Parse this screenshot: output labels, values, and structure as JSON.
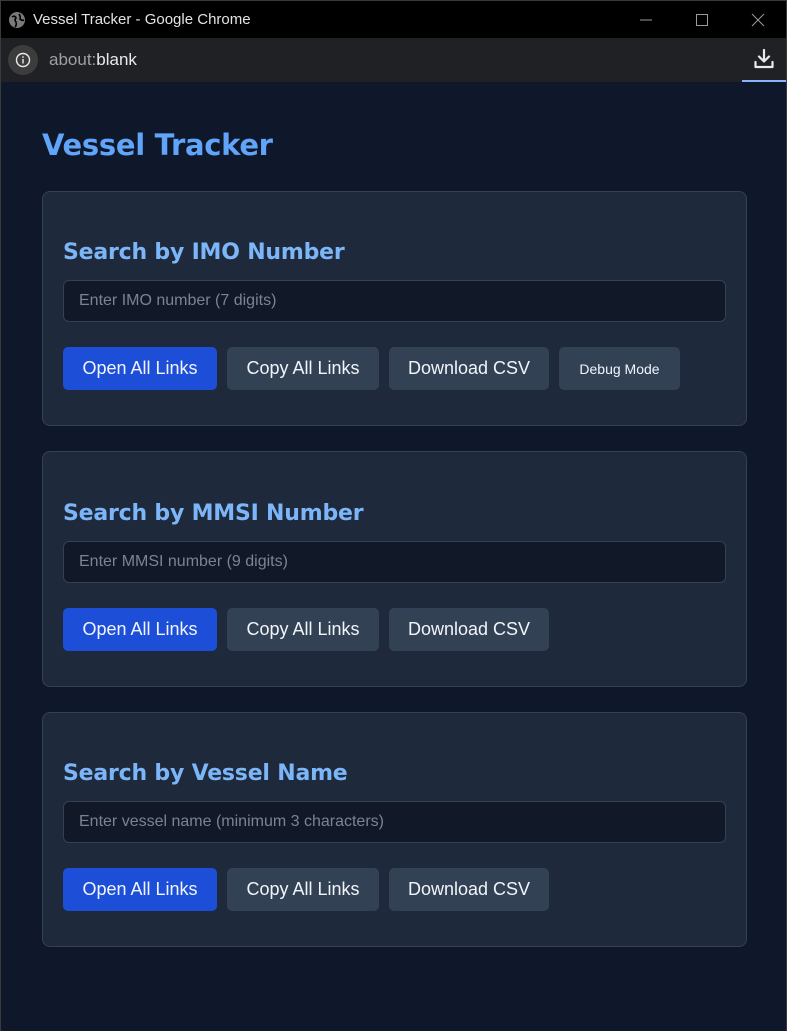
{
  "window": {
    "title": "Vessel Tracker - Google Chrome"
  },
  "address_bar": {
    "scheme": "about:",
    "host": "blank"
  },
  "page": {
    "title": "Vessel Tracker"
  },
  "sections": {
    "imo": {
      "heading": "Search by IMO Number",
      "placeholder": "Enter IMO number (7 digits)",
      "value": "",
      "open_label": "Open All Links",
      "copy_label": "Copy All Links",
      "csv_label": "Download CSV",
      "debug_label": "Debug Mode"
    },
    "mmsi": {
      "heading": "Search by MMSI Number",
      "placeholder": "Enter MMSI number (9 digits)",
      "value": "",
      "open_label": "Open All Links",
      "copy_label": "Copy All Links",
      "csv_label": "Download CSV"
    },
    "name": {
      "heading": "Search by Vessel Name",
      "placeholder": "Enter vessel name (minimum 3 characters)",
      "value": "",
      "open_label": "Open All Links",
      "copy_label": "Copy All Links",
      "csv_label": "Download CSV"
    }
  },
  "icons": {
    "window": "globe-icon",
    "minimize": "minimize-icon",
    "maximize": "maximize-icon",
    "close": "close-icon",
    "site_info": "info-icon",
    "download": "download-icon"
  },
  "colors": {
    "page_background": "#0f172a",
    "card_background": "#1e293b",
    "accent": "#60a5fa",
    "primary_button": "#1d4ed8",
    "secondary_button": "#334155"
  }
}
